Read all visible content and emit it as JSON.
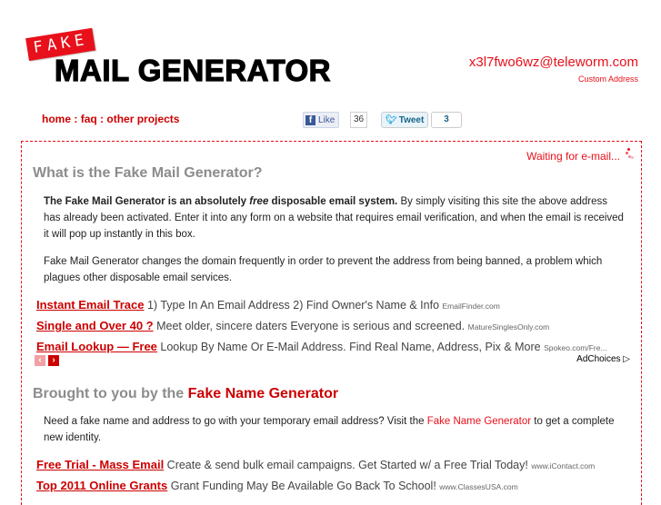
{
  "logo": {
    "fake": "FAKE",
    "main": "MAIL GENERATOR"
  },
  "address": {
    "email": "x3l7fwo6wz@teleworm.com",
    "custom_label": "Custom Address"
  },
  "nav": {
    "items": [
      "home",
      "faq",
      "other projects"
    ],
    "separator": ":"
  },
  "social": {
    "fb_icon": "f",
    "fb_label": "Like",
    "fb_count": "36",
    "tw_icon": "bird-icon",
    "tw_label": "Tweet",
    "tw_count": "3"
  },
  "status": {
    "waiting": "Waiting for e-mail..."
  },
  "section_what": {
    "heading": "What is the Fake Mail Generator?",
    "p1_bold_a": "The Fake Mail Generator is an absolutely ",
    "p1_italic": "free",
    "p1_bold_b": " disposable email system.",
    "p1_rest": " By simply visiting this site the above address has already been activated. Enter it into any form on a website that requires email verification, and when the email is received it will pop up instantly in this box.",
    "p2": "Fake Mail Generator changes the domain frequently in order to prevent the address from being banned, a problem which plagues other disposable email services."
  },
  "ads_top": [
    {
      "title": "Instant Email Trace",
      "text": " 1) Type In An Email Address 2) Find Owner's Name & Info ",
      "url": "EmailFinder.com"
    },
    {
      "title": "Single and Over 40 ?",
      "text": " Meet older, sincere daters Everyone is serious and screened. ",
      "url": "MatureSinglesOnly.com"
    },
    {
      "title": "Email Lookup — Free",
      "text": " Lookup By Name Or E-Mail Address. Find Real Name, Address, Pix & More ",
      "url": "Spokeo.com/Fre..."
    }
  ],
  "ad_controls": {
    "prev": "‹",
    "next": "›",
    "adchoices": "AdChoices ▷"
  },
  "section_brought": {
    "heading_gray": "Brought to you by the ",
    "heading_red": "Fake Name Generator",
    "p_a": "Need a fake name and address to go with your temporary email address? Visit the ",
    "p_link": "Fake Name Generator",
    "p_b": " to get a complete new identity."
  },
  "ads_bottom": [
    {
      "title": "Free Trial - Mass Email",
      "text": " Create & send bulk email campaigns. Get Started w/ a Free Trial Today! ",
      "url": "www.iContact.com"
    },
    {
      "title": "Top 2011 Online Grants",
      "text": " Grant Funding May Be Available Go Back To School! ",
      "url": "www.ClassesUSA.com"
    }
  ]
}
